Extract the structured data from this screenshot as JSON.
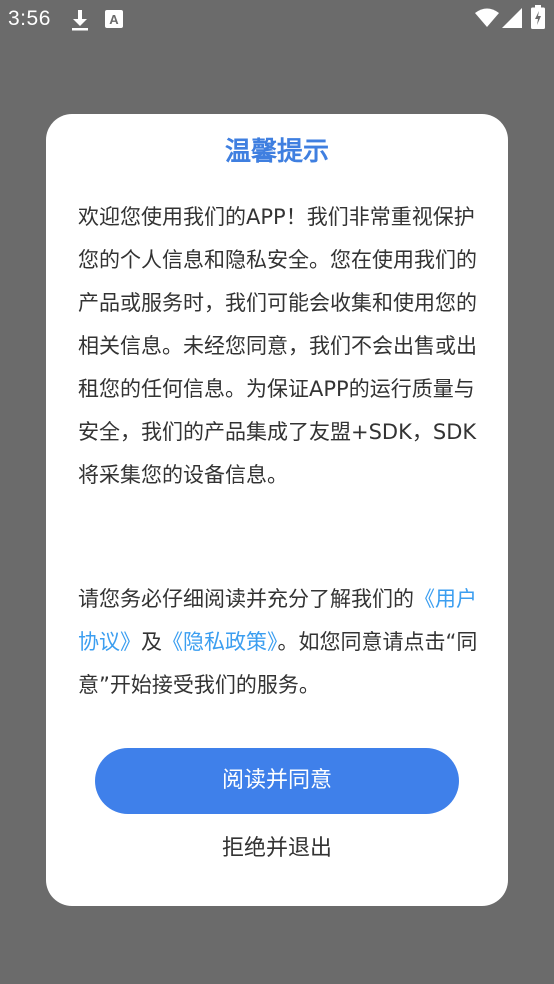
{
  "status_bar": {
    "time": "3:56",
    "icons": [
      "download-icon",
      "a-keyboard-icon",
      "wifi-icon",
      "signal-icon",
      "battery-icon"
    ],
    "color": "#ffffff"
  },
  "dialog": {
    "title": "温馨提示",
    "title_color": "#3f7fe0",
    "paragraph1": "欢迎您使用我们的APP！我们非常重视保护您的个人信息和隐私安全。您在使用我们的产品或服务时，我们可能会收集和使用您的相关信息。未经您同意，我们不会出售或出租您的任何信息。为保证APP的运行质量与安全，我们的产品集成了友盟+SDK，SDK将采集您的设备信息。",
    "paragraph2": {
      "lead": "请您务必仔细阅读并充分了解我们的",
      "user_agreement_link": "《用户协议》",
      "and": "及",
      "privacy_policy_link": "《隐私政策》",
      "tail": "。如您同意请点击“同意”开始接受我们的服务。"
    },
    "link_color": "#3b9ef0",
    "agree_button_label": "阅读并同意",
    "agree_button_color": "#3f80ea",
    "reject_button_label": "拒绝并退出"
  }
}
